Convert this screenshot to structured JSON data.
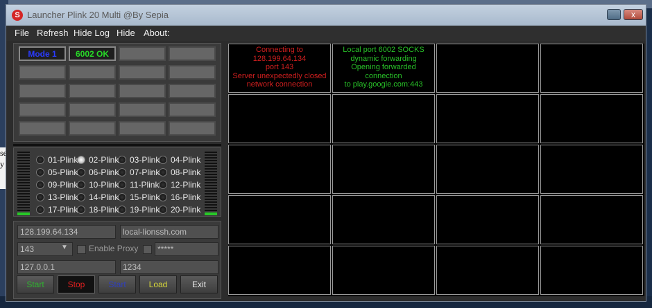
{
  "window": {
    "title": "Launcher Plink 20 Multi @By Sepia",
    "app_icon_letter": "S",
    "close_glyph": "x"
  },
  "background": {
    "fragment": "se\ny"
  },
  "menu": [
    "File",
    "Refresh",
    "Hide Log",
    "Hide",
    "About:"
  ],
  "modes": {
    "mode_label": "Mode 1",
    "status_label": "6002 OK"
  },
  "plinks": [
    {
      "label": "01-Plink",
      "selected": false
    },
    {
      "label": "02-Plink",
      "selected": true
    },
    {
      "label": "03-Plink",
      "selected": false
    },
    {
      "label": "04-Plink",
      "selected": false
    },
    {
      "label": "05-Plink",
      "selected": false
    },
    {
      "label": "06-Plink",
      "selected": false
    },
    {
      "label": "07-Plink",
      "selected": false
    },
    {
      "label": "08-Plink",
      "selected": false
    },
    {
      "label": "09-Plink",
      "selected": false
    },
    {
      "label": "10-Plink",
      "selected": false
    },
    {
      "label": "11-Plink",
      "selected": false
    },
    {
      "label": "12-Plink",
      "selected": false
    },
    {
      "label": "13-Plink",
      "selected": false
    },
    {
      "label": "14-Plink",
      "selected": false
    },
    {
      "label": "15-Plink",
      "selected": false
    },
    {
      "label": "16-Plink",
      "selected": false
    },
    {
      "label": "17-Plink",
      "selected": false
    },
    {
      "label": "18-Plink",
      "selected": false
    },
    {
      "label": "19-Plink",
      "selected": false
    },
    {
      "label": "20-Plink",
      "selected": false
    }
  ],
  "settings": {
    "server_ip": "128.199.64.134",
    "host": "local-lionssh.com",
    "port": "143",
    "enable_proxy_label": "Enable Proxy",
    "password_mask": "*****",
    "local_ip": "127.0.0.1",
    "local_port": "1234"
  },
  "buttons": {
    "start": "Start",
    "stop": "Stop",
    "start2": "Start",
    "load": "Load",
    "exit": "Exit"
  },
  "logs": {
    "cell1": "Connecting to 128.199.64.134\nport 143\nServer unexpectedly closed\nnetwork connection",
    "cell2": "Local port 6002 SOCKS\ndynamic forwarding\nOpening forwarded connection\nto play.google.com:443"
  },
  "colors": {
    "log_error": "#d21f1f",
    "log_ok": "#28c028",
    "mode_text": "#2a3bff",
    "status_ok": "#27d827",
    "stop_text": "#e32020"
  }
}
